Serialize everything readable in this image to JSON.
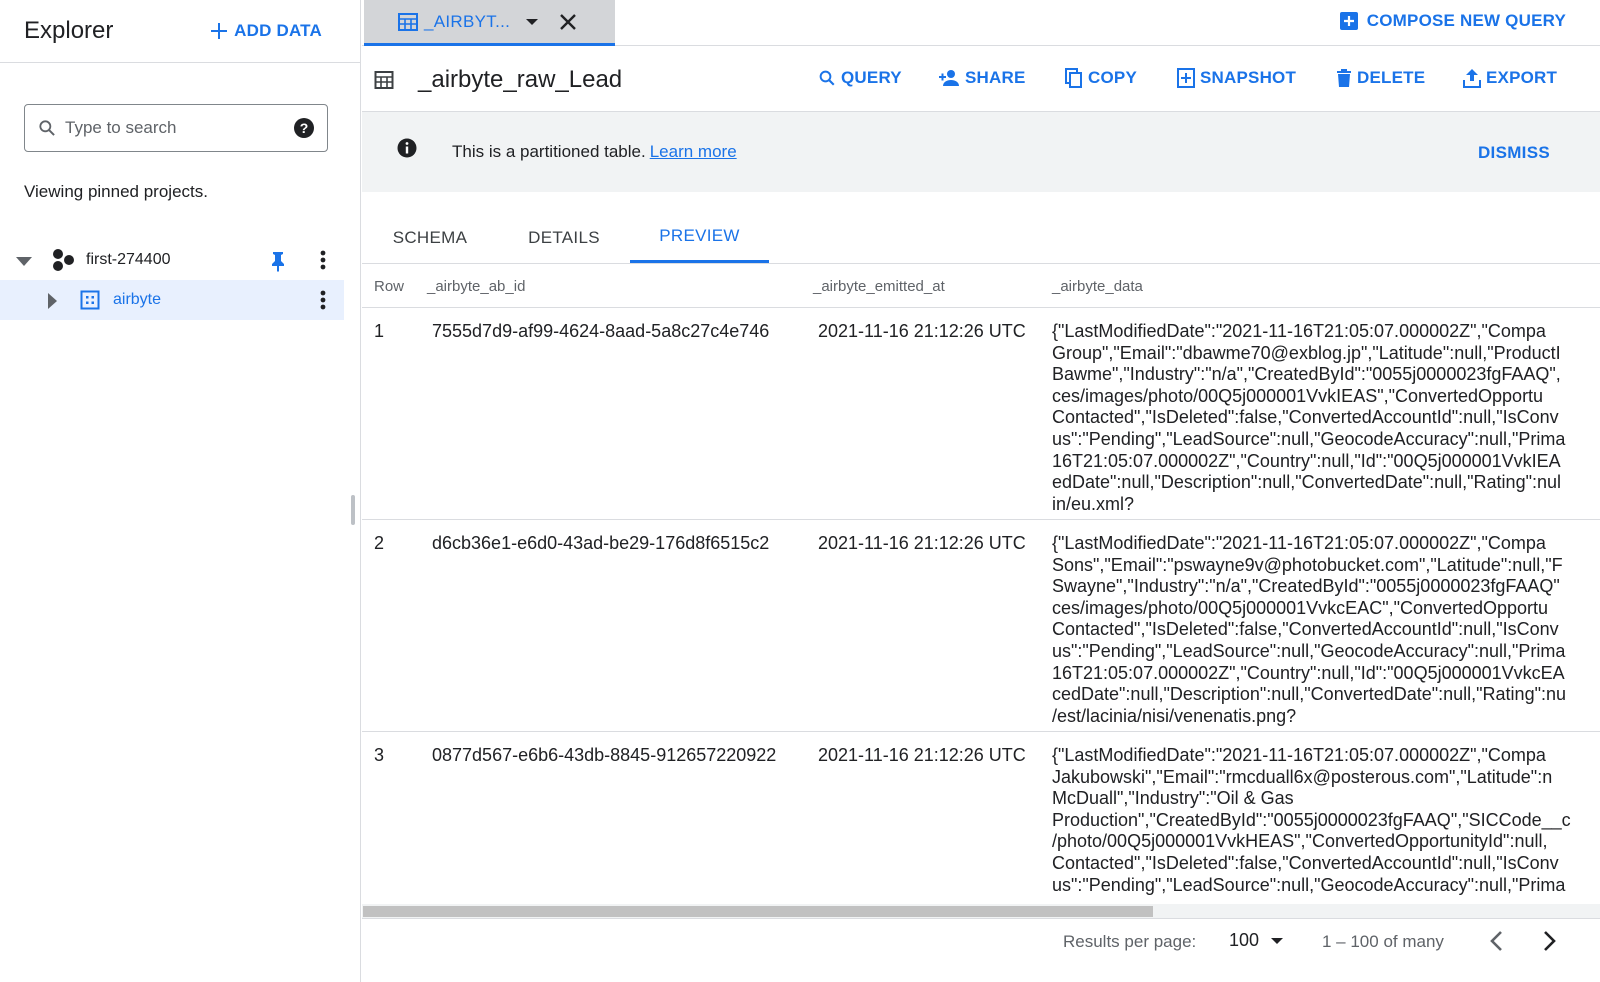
{
  "sidebar": {
    "title": "Explorer",
    "add_data": "ADD DATA",
    "search_placeholder": "Type to search",
    "viewing": "Viewing pinned projects.",
    "project": "first-274400",
    "dataset": "airbyte"
  },
  "tab": {
    "label": "_AIRBYT..."
  },
  "compose": "COMPOSE NEW QUERY",
  "table": {
    "title": "_airbyte_raw_Lead"
  },
  "actions": {
    "query": "QUERY",
    "share": "SHARE",
    "copy": "COPY",
    "snapshot": "SNAPSHOT",
    "delete": "DELETE",
    "export": "EXPORT"
  },
  "banner": {
    "text": "This is a partitioned table.",
    "link": "Learn more",
    "dismiss": "DISMISS"
  },
  "subtabs": [
    "SCHEMA",
    "DETAILS",
    "PREVIEW"
  ],
  "grid": {
    "columns": [
      "Row",
      "_airbyte_ab_id",
      "_airbyte_emitted_at",
      "_airbyte_data"
    ],
    "rows": [
      {
        "row": "1",
        "id": "7555d7d9-af99-4624-8aad-5a8c27c4e746",
        "emitted": "2021-11-16 21:12:26 UTC",
        "data": [
          " {\"LastModifiedDate\":\"2021-11-16T21:05:07.000002Z\",\"Compa",
          "Group\",\"Email\":\"dbawme70@exblog.jp\",\"Latitude\":null,\"ProductI",
          "Bawme\",\"Industry\":\"n/a\",\"CreatedById\":\"0055j0000023fgFAAQ\",",
          "ces/images/photo/00Q5j000001VvkIEAS\",\"ConvertedOpportu",
          "Contacted\",\"IsDeleted\":false,\"ConvertedAccountId\":null,\"IsConv",
          "us\":\"Pending\",\"LeadSource\":null,\"GeocodeAccuracy\":null,\"Prima",
          "16T21:05:07.000002Z\",\"Country\":null,\"Id\":\"00Q5j000001VvkIEA",
          "edDate\":null,\"Description\":null,\"ConvertedDate\":null,\"Rating\":nul",
          "in/eu.xml?"
        ]
      },
      {
        "row": "2",
        "id": "d6cb36e1-e6d0-43ad-be29-176d8f6515c2",
        "emitted": "2021-11-16 21:12:26 UTC",
        "data": [
          " {\"LastModifiedDate\":\"2021-11-16T21:05:07.000002Z\",\"Compa",
          "Sons\",\"Email\":\"pswayne9v@photobucket.com\",\"Latitude\":null,\"F",
          "Swayne\",\"Industry\":\"n/a\",\"CreatedById\":\"0055j0000023fgFAAQ\"",
          "ces/images/photo/00Q5j000001VvkcEAC\",\"ConvertedOpportu",
          "Contacted\",\"IsDeleted\":false,\"ConvertedAccountId\":null,\"IsConv",
          "us\":\"Pending\",\"LeadSource\":null,\"GeocodeAccuracy\":null,\"Prima",
          "16T21:05:07.000002Z\",\"Country\":null,\"Id\":\"00Q5j000001VvkcEA",
          "cedDate\":null,\"Description\":null,\"ConvertedDate\":null,\"Rating\":nu",
          "/est/lacinia/nisi/venenatis.png?"
        ]
      },
      {
        "row": "3",
        "id": "0877d567-e6b6-43db-8845-912657220922",
        "emitted": "2021-11-16 21:12:26 UTC",
        "data": [
          " {\"LastModifiedDate\":\"2021-11-16T21:05:07.000002Z\",\"Compa",
          "Jakubowski\",\"Email\":\"rmcduall6x@posterous.com\",\"Latitude\":n",
          "McDuall\",\"Industry\":\"Oil & Gas",
          "Production\",\"CreatedById\":\"0055j0000023fgFAAQ\",\"SICCode__c",
          "/photo/00Q5j000001VvkHEAS\",\"ConvertedOpportunityId\":null,",
          "Contacted\",\"IsDeleted\":false,\"ConvertedAccountId\":null,\"IsConv",
          "us\":\"Pending\",\"LeadSource\":null,\"GeocodeAccuracy\":null,\"Prima"
        ]
      }
    ]
  },
  "footer": {
    "results_label": "Results per page:",
    "per_page": "100",
    "range": "1 – 100 of many"
  }
}
